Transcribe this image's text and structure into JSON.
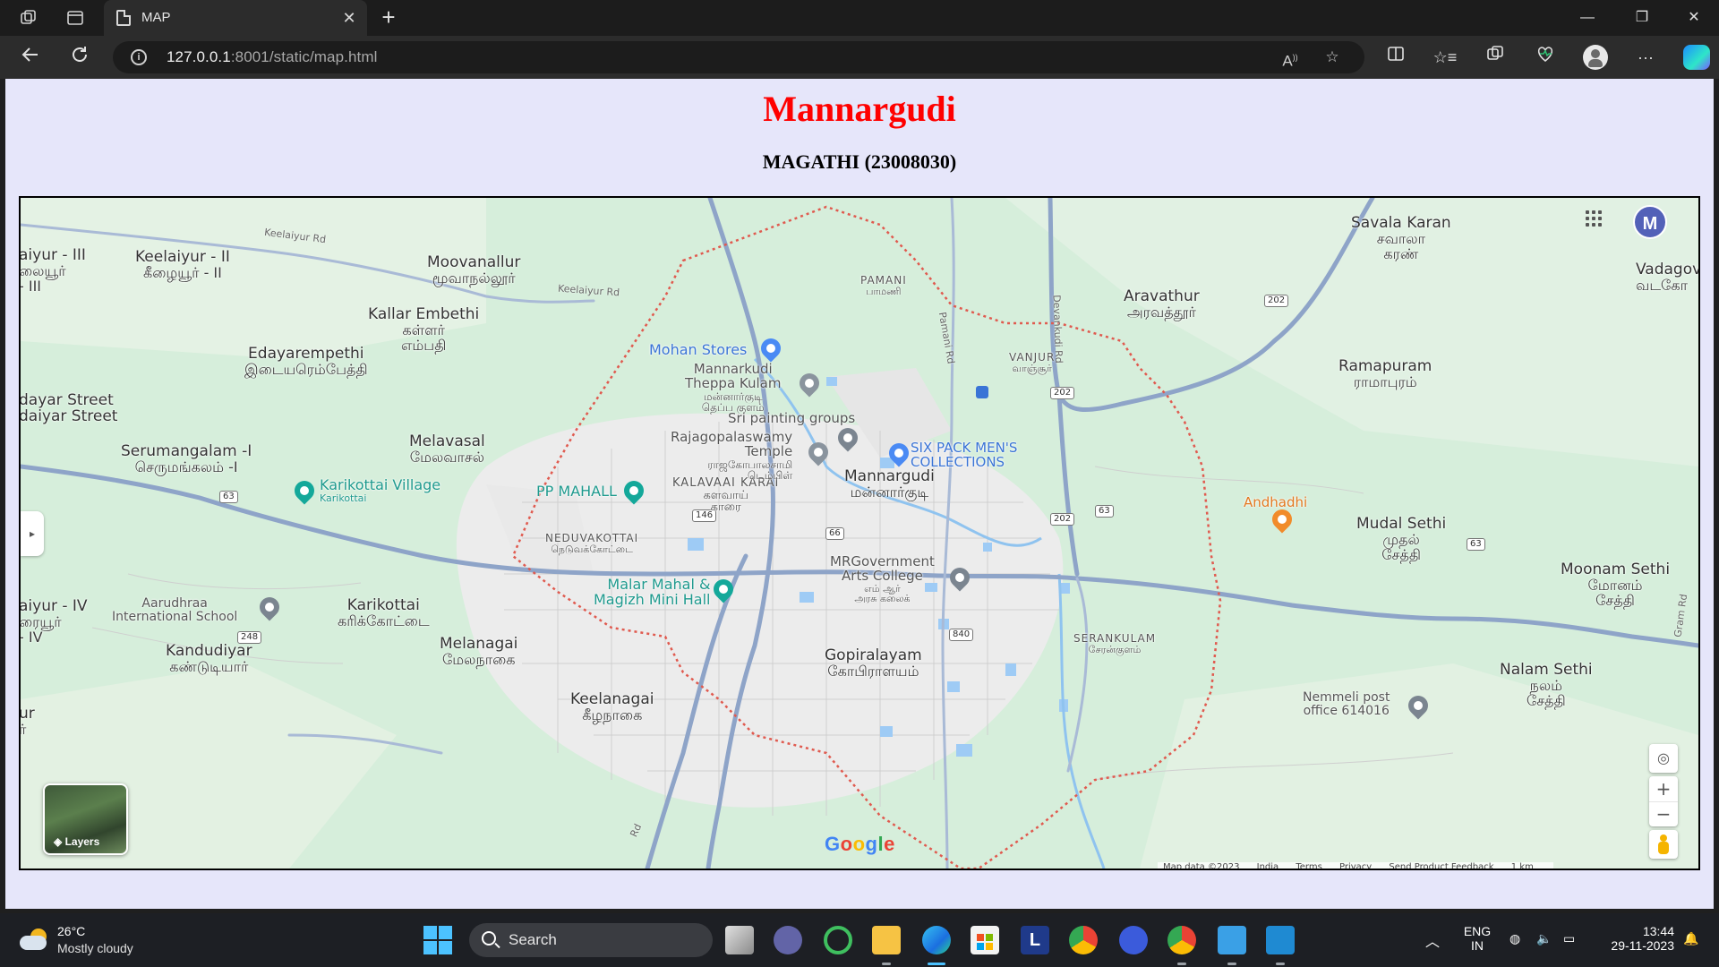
{
  "browser": {
    "tab_title": "MAP",
    "tab_close": "✕",
    "new_tab": "+",
    "url_host": "127.0.0.1",
    "url_path": ":8001/static/map.html",
    "window_controls": {
      "minimize": "—",
      "maximize": "❐",
      "close": "✕"
    },
    "more_tools": "···"
  },
  "page": {
    "title": "Mannargudi",
    "subtitle": "MAGATHI (23008030)"
  },
  "map": {
    "account_initial": "M",
    "layers_label": "Layers",
    "google_logo": "Google",
    "attribution": [
      "Map data ©2023",
      "India",
      "Terms",
      "Privacy",
      "Send Product Feedback",
      "1 km"
    ],
    "zoom_in": "+",
    "zoom_out": "−",
    "places": [
      {
        "en": "aiyur - III",
        "ta": "லையூர்",
        "ta2": "- III"
      },
      {
        "en": "Keelaiyur - II",
        "ta": "கீழையூர் - II"
      },
      {
        "en": "Moovanallur",
        "ta": "மூவாநல்லூர்"
      },
      {
        "en": "Kallar Embethi",
        "ta": "கள்ளர்",
        "ta2": "எம்பதி"
      },
      {
        "en": "Edayarempethi",
        "ta": "இடையரெம்பேத்தி"
      },
      {
        "en": "dayar Street",
        "ta": "daiyar Street"
      },
      {
        "en": "Melavasal",
        "ta": "மேலவாசல்"
      },
      {
        "en": "Serumangalam -I",
        "ta": "செருமங்கலம் -I"
      },
      {
        "en": "aiyur - IV",
        "ta": "ரையூர்",
        "ta2": "- IV"
      },
      {
        "en": "Karikottai",
        "ta": "கரிக்கோட்டை"
      },
      {
        "en": "Kandudiyar",
        "ta": "கண்டுடியார்"
      },
      {
        "en": "Melanagai",
        "ta": "மேலநாகை"
      },
      {
        "en": "Keelanagai",
        "ta": "கீழநாகை"
      },
      {
        "en": "Mannargudi",
        "ta": "மன்னார்குடி"
      },
      {
        "en": "Gopiralayam",
        "ta": "கோபிராளயம்"
      },
      {
        "en": "Savala Karan",
        "ta": "சவாலா",
        "ta2": "கரண்"
      },
      {
        "en": "Aravathur",
        "ta": "அரவத்தூர்"
      },
      {
        "en": "Ramapuram",
        "ta": "ராமாபுரம்"
      },
      {
        "en": "Vadagov",
        "ta": "வடகோ"
      },
      {
        "en": "Mudal Sethi",
        "ta": "முதல்",
        "ta2": "சேத்தி"
      },
      {
        "en": "Moonam Sethi",
        "ta": "மோனம்",
        "ta2": "சேத்தி"
      },
      {
        "en": "Nalam Sethi",
        "ta": "நலம்",
        "ta2": "சேத்தி"
      },
      {
        "en": "ur",
        "ta": "ர்"
      }
    ],
    "small_places": [
      {
        "en": "PAMANI",
        "ta": "பாமணி"
      },
      {
        "en": "VANJUR",
        "ta": "வாஞ்சூர்"
      },
      {
        "en": "KALAVAAI KARAI",
        "ta": "களவாய்",
        "ta2": "காரை"
      },
      {
        "en": "NEDUVAKOTTAI",
        "ta": "நெடுவக்கோட்டை"
      },
      {
        "en": "SERANKULAM",
        "ta": "சேரன்குளம்"
      }
    ],
    "pois": {
      "mohan_stores": "Mohan Stores",
      "mannarkudi_theppa": "Mannarkudi",
      "mannarkudi_theppa2": "Theppa Kulam",
      "mannarkudi_theppa_ta": "மன்னார்குடி",
      "mannarkudi_theppa_ta2": "தெப்ப குளம்",
      "sri_painting": "Sri painting groups",
      "rajagopalaswamy": "Rajagopalaswamy",
      "rajagopalaswamy2": "Temple",
      "rajagopalaswamy_ta": "ராஜகோபாலசாமி",
      "rajagopalaswamy_ta2": "டெம்பிள்",
      "six_pack": "SIX PACK MEN'S",
      "six_pack2": "COLLECTIONS",
      "pp_mahall": "PP MAHALL",
      "karikottai_village": "Karikottai Village",
      "karikottai_village_sub": "Karikottai",
      "malar_mahal": "Malar Mahal &",
      "malar_mahal2": "Magizh Mini Hall",
      "mr_govt": "MRGovernment",
      "mr_govt2": "Arts College",
      "mr_govt_ta": "எம் ஆர்",
      "mr_govt_ta2": "அரசு கலைக்",
      "aarudhraa": "Aarudhraa",
      "aarudhraa2": "International School",
      "andhadhi": "Andhadhi",
      "nemmeli": "Nemmeli post",
      "nemmeli2": "office 614016"
    },
    "road_labels": {
      "keelaiyur_rd1": "Keelaiyur Rd",
      "keelaiyur_rd2": "Keelaiyur Rd",
      "pamani_rd": "Pamani Rd",
      "devankudi_rd": "Devankudi Rd",
      "gram_rd": "Gram Rd",
      "rd_bottom": "Rd"
    },
    "shields": [
      "63",
      "146",
      "66",
      "202",
      "202",
      "202",
      "63",
      "63",
      "248",
      "840"
    ]
  },
  "taskbar": {
    "temperature": "26°C",
    "weather": "Mostly cloudy",
    "search_placeholder": "Search",
    "lang": "ENG",
    "region": "IN",
    "time": "13:44",
    "date": "29-11-2023"
  },
  "colors": {
    "page_bg": "#e6e6fa",
    "title_red": "#ff0000",
    "map_green": "#d7efdc",
    "boundary_red": "#e05a4f",
    "road_blue": "#8ea4c8"
  }
}
